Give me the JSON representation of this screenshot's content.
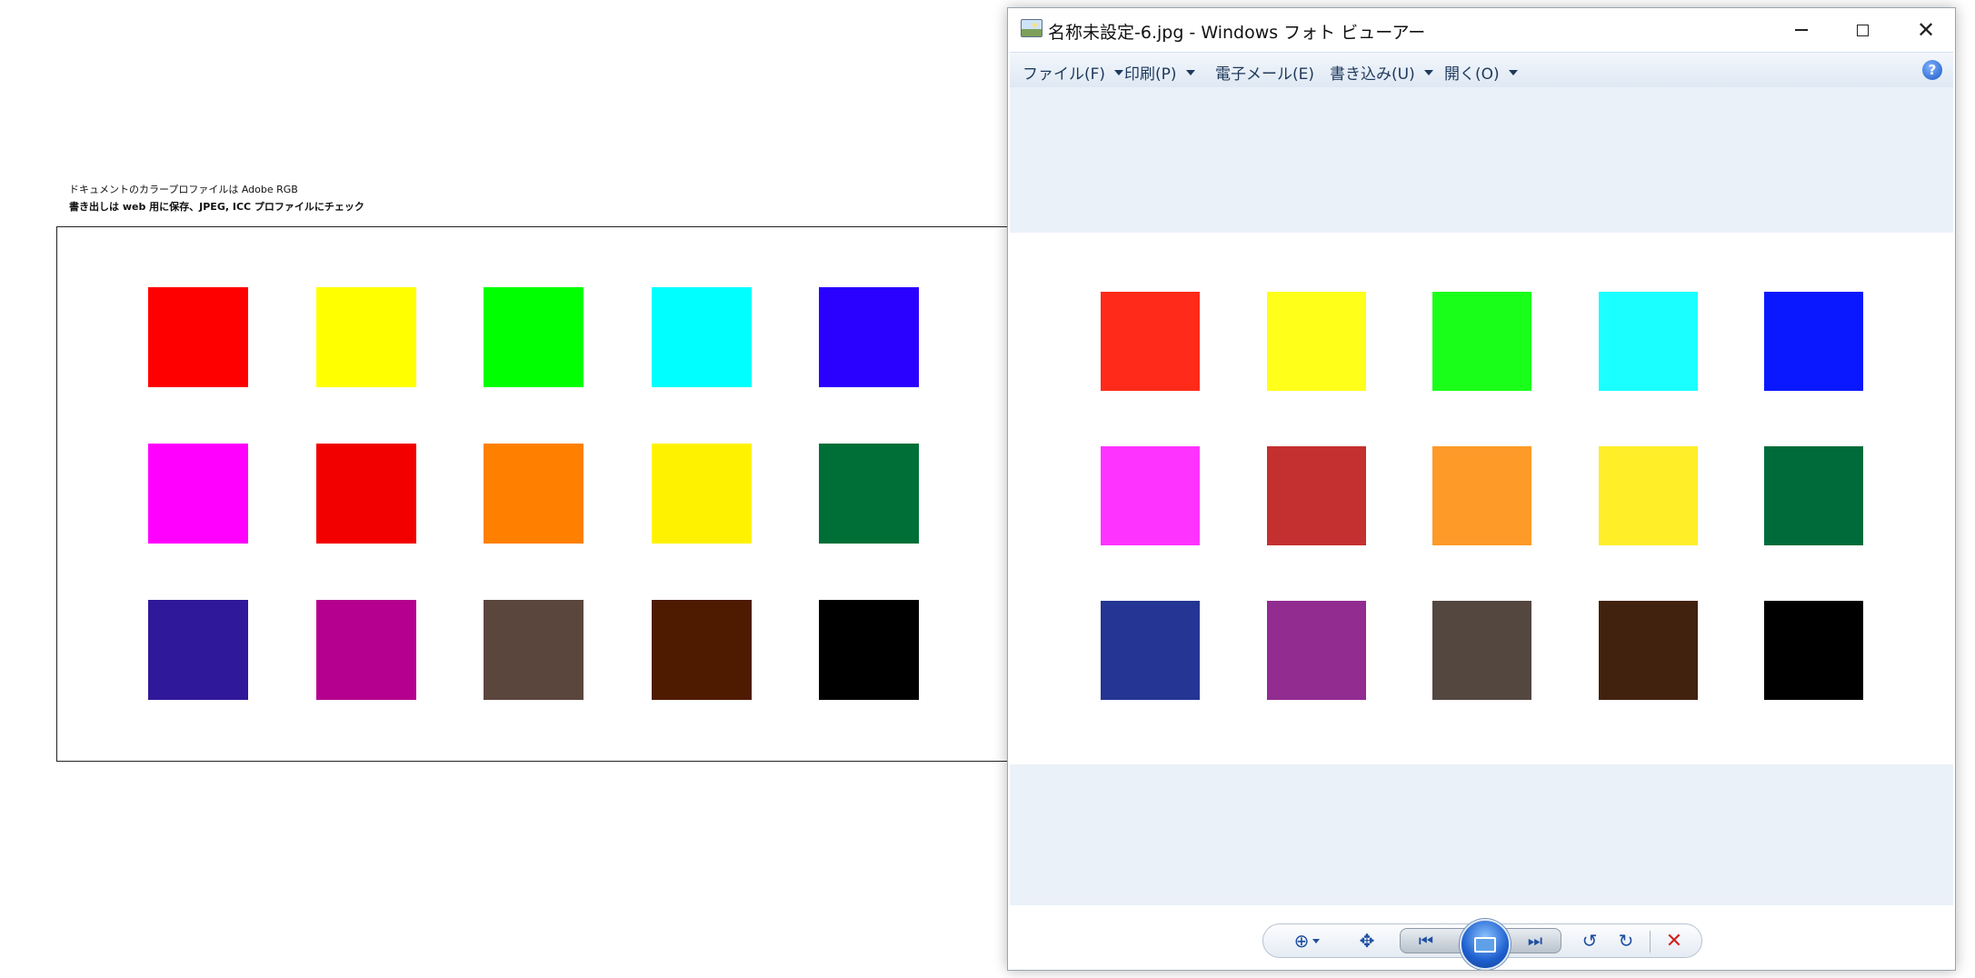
{
  "document": {
    "note_line1": "ドキュメントのカラープロファイルは Adobe RGB",
    "note_line2": "書き出しは web 用に保存、JPEG, ICC プロファイルにチェック",
    "swatches": [
      [
        "#ff0000",
        "#ffff00",
        "#00ff00",
        "#00ffff",
        "#2a00ff"
      ],
      [
        "#ff00ff",
        "#f20000",
        "#ff8000",
        "#fff200",
        "#006f37"
      ],
      [
        "#30189a",
        "#b5008f",
        "#5b463e",
        "#4f1b00",
        "#000000"
      ]
    ]
  },
  "viewer": {
    "title": "名称未設定-6.jpg - Windows フォト ビューアー",
    "menu": [
      {
        "label": "ファイル(F)",
        "dropdown": true
      },
      {
        "label": "印刷(P)",
        "dropdown": true
      },
      {
        "label": "電子メール(E)",
        "dropdown": false
      },
      {
        "label": "書き込み(U)",
        "dropdown": true
      },
      {
        "label": "開く(O)",
        "dropdown": true
      }
    ],
    "help_glyph": "?",
    "close_glyph": "✕",
    "swatches": [
      [
        "#ff2a1a",
        "#ffff1a",
        "#1aff1a",
        "#1affff",
        "#0a18ff"
      ],
      [
        "#ff33ff",
        "#c43030",
        "#fd9a28",
        "#ffee28",
        "#006b3a"
      ],
      [
        "#243593",
        "#922c91",
        "#544740",
        "#41220f",
        "#000000"
      ]
    ],
    "toolbar": {
      "zoom_glyph": "⊕",
      "fit_glyph": "✥",
      "prev_glyph": "⏮",
      "next_glyph": "⏭",
      "rotate_ccw_glyph": "↺",
      "rotate_cw_glyph": "↻",
      "delete_glyph": "✕"
    },
    "colors": {
      "menu_text": "#1e395b",
      "delete": "#d0231f",
      "toolbar_icon": "#1f4fa0"
    }
  }
}
